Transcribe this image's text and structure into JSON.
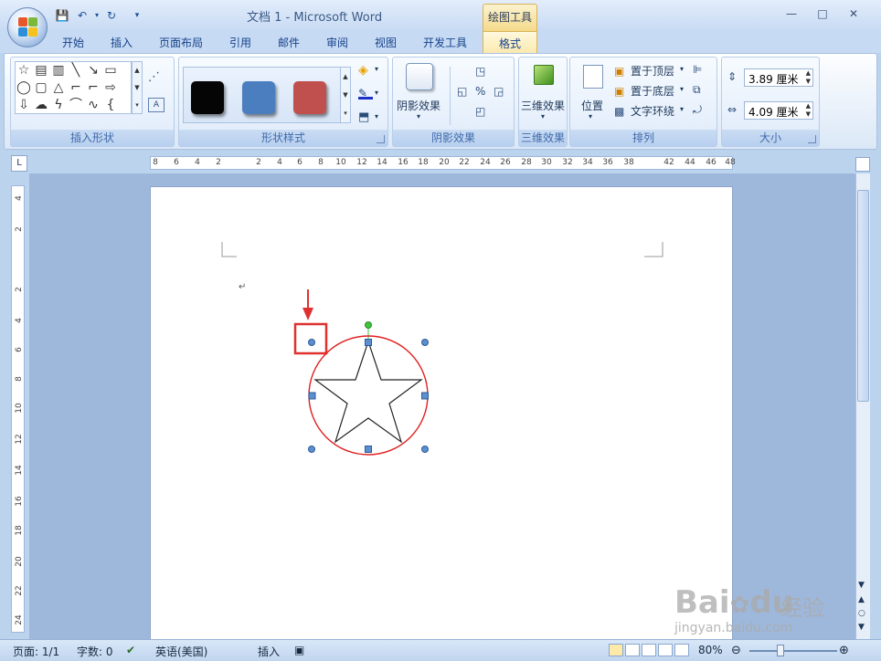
{
  "window": {
    "title": "文档 1 - Microsoft Word",
    "context_tab_head": "绘图工具",
    "min_glyph": "—",
    "max_glyph": "□",
    "close_glyph": "✕"
  },
  "tabs": [
    "开始",
    "插入",
    "页面布局",
    "引用",
    "邮件",
    "审阅",
    "视图",
    "开发工具"
  ],
  "active_tab": "格式",
  "ribbon": {
    "insert_shapes": {
      "label": "插入形状"
    },
    "shape_styles": {
      "label": "形状样式",
      "swatches": [
        "#050505",
        "#4a7ebf",
        "#c0504d"
      ]
    },
    "shadow": {
      "label": "阴影效果",
      "button_label": "阴影效果"
    },
    "effects_3d": {
      "label": "三维效果",
      "button_label": "三维效果"
    },
    "arrange": {
      "label": "排列",
      "position_label": "位置",
      "bring_front": "置于顶层",
      "send_back": "置于底层",
      "text_wrap": "文字环绕"
    },
    "size": {
      "label": "大小",
      "height": "3.89 厘米",
      "width": "4.09 厘米"
    }
  },
  "ruler": {
    "ruler_toggle": "L",
    "h_labels": [
      "8",
      "6",
      "4",
      "2",
      "2",
      "4",
      "6",
      "8",
      "10",
      "12",
      "14",
      "16",
      "18",
      "20",
      "22",
      "24",
      "26",
      "28",
      "30",
      "32",
      "34",
      "36",
      "38",
      "42",
      "44",
      "46",
      "48"
    ],
    "v_labels": [
      "4",
      "2",
      "2",
      "4",
      "6",
      "8",
      "10",
      "12",
      "14",
      "16",
      "18",
      "20",
      "22",
      "24"
    ]
  },
  "document": {
    "paragraph_mark": "↵"
  },
  "status": {
    "page": "页面: 1/1",
    "words": "字数: 0",
    "language": "英语(美国)",
    "mode": "插入",
    "zoom": "80%"
  },
  "colors": {
    "accent_red": "#e03030",
    "handle_blue": "#5b8fd0",
    "rotate_handle": "#3ec43e",
    "circle_outline": "#e02020"
  },
  "watermark": {
    "brand": "Bai",
    "brand_end": "du",
    "cn": "经验",
    "url": "jingyan.baidu.com"
  }
}
